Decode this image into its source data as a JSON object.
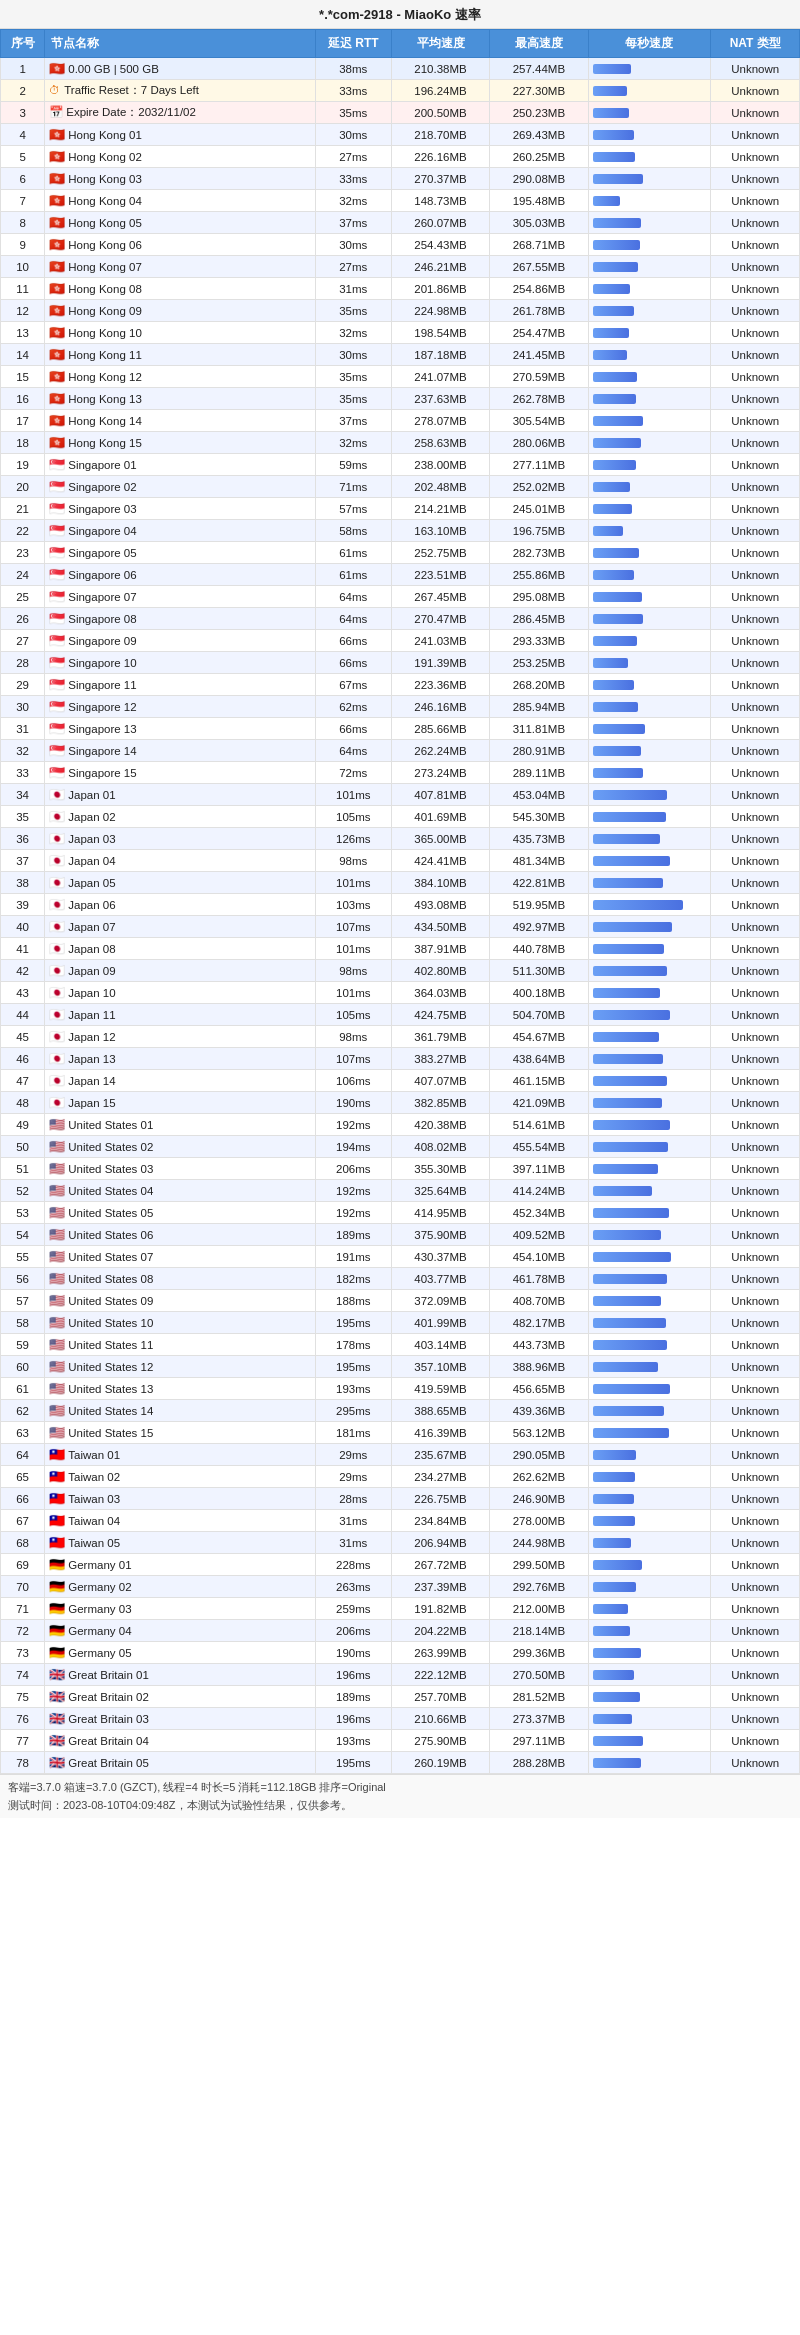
{
  "title": "*.*com-2918 - MiaoKo 速率",
  "headers": [
    "序号",
    "节点名称",
    "延迟 RTT",
    "平均速度",
    "最高速度",
    "每秒速度",
    "NAT 类型"
  ],
  "rows": [
    {
      "id": 1,
      "name": "0.00 GB | 500 GB",
      "flag": "🇭🇰",
      "rtt": "38ms",
      "avg": "210.38MB",
      "max": "257.44MB",
      "bar": 42,
      "nat": "Unknown",
      "special": "speed"
    },
    {
      "id": 2,
      "name": "Traffic Reset：7 Days Left",
      "flag": "",
      "rtt": "33ms",
      "avg": "196.24MB",
      "max": "227.30MB",
      "bar": 38,
      "nat": "Unknown",
      "special": "traffic"
    },
    {
      "id": 3,
      "name": "Expire Date：2032/11/02",
      "flag": "",
      "rtt": "35ms",
      "avg": "200.50MB",
      "max": "250.23MB",
      "bar": 40,
      "nat": "Unknown",
      "special": "expire"
    },
    {
      "id": 4,
      "name": "Hong Kong 01",
      "flag": "🇭🇰",
      "rtt": "30ms",
      "avg": "218.70MB",
      "max": "269.43MB",
      "bar": 45,
      "nat": "Unknown"
    },
    {
      "id": 5,
      "name": "Hong Kong 02",
      "flag": "🇭🇰",
      "rtt": "27ms",
      "avg": "226.16MB",
      "max": "260.25MB",
      "bar": 47,
      "nat": "Unknown"
    },
    {
      "id": 6,
      "name": "Hong Kong 03",
      "flag": "🇭🇰",
      "rtt": "33ms",
      "avg": "270.37MB",
      "max": "290.08MB",
      "bar": 55,
      "nat": "Unknown"
    },
    {
      "id": 7,
      "name": "Hong Kong 04",
      "flag": "🇭🇰",
      "rtt": "32ms",
      "avg": "148.73MB",
      "max": "195.48MB",
      "bar": 30,
      "nat": "Unknown"
    },
    {
      "id": 8,
      "name": "Hong Kong 05",
      "flag": "🇭🇰",
      "rtt": "37ms",
      "avg": "260.07MB",
      "max": "305.03MB",
      "bar": 53,
      "nat": "Unknown"
    },
    {
      "id": 9,
      "name": "Hong Kong 06",
      "flag": "🇭🇰",
      "rtt": "30ms",
      "avg": "254.43MB",
      "max": "268.71MB",
      "bar": 52,
      "nat": "Unknown"
    },
    {
      "id": 10,
      "name": "Hong Kong 07",
      "flag": "🇭🇰",
      "rtt": "27ms",
      "avg": "246.21MB",
      "max": "267.55MB",
      "bar": 50,
      "nat": "Unknown"
    },
    {
      "id": 11,
      "name": "Hong Kong 08",
      "flag": "🇭🇰",
      "rtt": "31ms",
      "avg": "201.86MB",
      "max": "254.86MB",
      "bar": 41,
      "nat": "Unknown"
    },
    {
      "id": 12,
      "name": "Hong Kong 09",
      "flag": "🇭🇰",
      "rtt": "35ms",
      "avg": "224.98MB",
      "max": "261.78MB",
      "bar": 46,
      "nat": "Unknown"
    },
    {
      "id": 13,
      "name": "Hong Kong 10",
      "flag": "🇭🇰",
      "rtt": "32ms",
      "avg": "198.54MB",
      "max": "254.47MB",
      "bar": 40,
      "nat": "Unknown"
    },
    {
      "id": 14,
      "name": "Hong Kong 11",
      "flag": "🇭🇰",
      "rtt": "30ms",
      "avg": "187.18MB",
      "max": "241.45MB",
      "bar": 38,
      "nat": "Unknown"
    },
    {
      "id": 15,
      "name": "Hong Kong 12",
      "flag": "🇭🇰",
      "rtt": "35ms",
      "avg": "241.07MB",
      "max": "270.59MB",
      "bar": 49,
      "nat": "Unknown"
    },
    {
      "id": 16,
      "name": "Hong Kong 13",
      "flag": "🇭🇰",
      "rtt": "35ms",
      "avg": "237.63MB",
      "max": "262.78MB",
      "bar": 48,
      "nat": "Unknown"
    },
    {
      "id": 17,
      "name": "Hong Kong 14",
      "flag": "🇭🇰",
      "rtt": "37ms",
      "avg": "278.07MB",
      "max": "305.54MB",
      "bar": 56,
      "nat": "Unknown"
    },
    {
      "id": 18,
      "name": "Hong Kong 15",
      "flag": "🇭🇰",
      "rtt": "32ms",
      "avg": "258.63MB",
      "max": "280.06MB",
      "bar": 53,
      "nat": "Unknown"
    },
    {
      "id": 19,
      "name": "Singapore 01",
      "flag": "🇸🇬",
      "rtt": "59ms",
      "avg": "238.00MB",
      "max": "277.11MB",
      "bar": 48,
      "nat": "Unknown"
    },
    {
      "id": 20,
      "name": "Singapore 02",
      "flag": "🇸🇬",
      "rtt": "71ms",
      "avg": "202.48MB",
      "max": "252.02MB",
      "bar": 41,
      "nat": "Unknown"
    },
    {
      "id": 21,
      "name": "Singapore 03",
      "flag": "🇸🇬",
      "rtt": "57ms",
      "avg": "214.21MB",
      "max": "245.01MB",
      "bar": 43,
      "nat": "Unknown"
    },
    {
      "id": 22,
      "name": "Singapore 04",
      "flag": "🇸🇬",
      "rtt": "58ms",
      "avg": "163.10MB",
      "max": "196.75MB",
      "bar": 33,
      "nat": "Unknown"
    },
    {
      "id": 23,
      "name": "Singapore 05",
      "flag": "🇸🇬",
      "rtt": "61ms",
      "avg": "252.75MB",
      "max": "282.73MB",
      "bar": 51,
      "nat": "Unknown"
    },
    {
      "id": 24,
      "name": "Singapore 06",
      "flag": "🇸🇬",
      "rtt": "61ms",
      "avg": "223.51MB",
      "max": "255.86MB",
      "bar": 45,
      "nat": "Unknown"
    },
    {
      "id": 25,
      "name": "Singapore 07",
      "flag": "🇸🇬",
      "rtt": "64ms",
      "avg": "267.45MB",
      "max": "295.08MB",
      "bar": 54,
      "nat": "Unknown"
    },
    {
      "id": 26,
      "name": "Singapore 08",
      "flag": "🇸🇬",
      "rtt": "64ms",
      "avg": "270.47MB",
      "max": "286.45MB",
      "bar": 55,
      "nat": "Unknown"
    },
    {
      "id": 27,
      "name": "Singapore 09",
      "flag": "🇸🇬",
      "rtt": "66ms",
      "avg": "241.03MB",
      "max": "293.33MB",
      "bar": 49,
      "nat": "Unknown"
    },
    {
      "id": 28,
      "name": "Singapore 10",
      "flag": "🇸🇬",
      "rtt": "66ms",
      "avg": "191.39MB",
      "max": "253.25MB",
      "bar": 39,
      "nat": "Unknown"
    },
    {
      "id": 29,
      "name": "Singapore 11",
      "flag": "🇸🇬",
      "rtt": "67ms",
      "avg": "223.36MB",
      "max": "268.20MB",
      "bar": 45,
      "nat": "Unknown"
    },
    {
      "id": 30,
      "name": "Singapore 12",
      "flag": "🇸🇬",
      "rtt": "62ms",
      "avg": "246.16MB",
      "max": "285.94MB",
      "bar": 50,
      "nat": "Unknown"
    },
    {
      "id": 31,
      "name": "Singapore 13",
      "flag": "🇸🇬",
      "rtt": "66ms",
      "avg": "285.66MB",
      "max": "311.81MB",
      "bar": 58,
      "nat": "Unknown"
    },
    {
      "id": 32,
      "name": "Singapore 14",
      "flag": "🇸🇬",
      "rtt": "64ms",
      "avg": "262.24MB",
      "max": "280.91MB",
      "bar": 53,
      "nat": "Unknown"
    },
    {
      "id": 33,
      "name": "Singapore 15",
      "flag": "🇸🇬",
      "rtt": "72ms",
      "avg": "273.24MB",
      "max": "289.11MB",
      "bar": 55,
      "nat": "Unknown"
    },
    {
      "id": 34,
      "name": "Japan 01",
      "flag": "🇯🇵",
      "rtt": "101ms",
      "avg": "407.81MB",
      "max": "453.04MB",
      "bar": 82,
      "nat": "Unknown"
    },
    {
      "id": 35,
      "name": "Japan 02",
      "flag": "🇯🇵",
      "rtt": "105ms",
      "avg": "401.69MB",
      "max": "545.30MB",
      "bar": 81,
      "nat": "Unknown"
    },
    {
      "id": 36,
      "name": "Japan 03",
      "flag": "🇯🇵",
      "rtt": "126ms",
      "avg": "365.00MB",
      "max": "435.73MB",
      "bar": 74,
      "nat": "Unknown"
    },
    {
      "id": 37,
      "name": "Japan 04",
      "flag": "🇯🇵",
      "rtt": "98ms",
      "avg": "424.41MB",
      "max": "481.34MB",
      "bar": 86,
      "nat": "Unknown"
    },
    {
      "id": 38,
      "name": "Japan 05",
      "flag": "🇯🇵",
      "rtt": "101ms",
      "avg": "384.10MB",
      "max": "422.81MB",
      "bar": 78,
      "nat": "Unknown"
    },
    {
      "id": 39,
      "name": "Japan 06",
      "flag": "🇯🇵",
      "rtt": "103ms",
      "avg": "493.08MB",
      "max": "519.95MB",
      "bar": 100,
      "nat": "Unknown"
    },
    {
      "id": 40,
      "name": "Japan 07",
      "flag": "🇯🇵",
      "rtt": "107ms",
      "avg": "434.50MB",
      "max": "492.97MB",
      "bar": 88,
      "nat": "Unknown"
    },
    {
      "id": 41,
      "name": "Japan 08",
      "flag": "🇯🇵",
      "rtt": "101ms",
      "avg": "387.91MB",
      "max": "440.78MB",
      "bar": 79,
      "nat": "Unknown"
    },
    {
      "id": 42,
      "name": "Japan 09",
      "flag": "🇯🇵",
      "rtt": "98ms",
      "avg": "402.80MB",
      "max": "511.30MB",
      "bar": 82,
      "nat": "Unknown"
    },
    {
      "id": 43,
      "name": "Japan 10",
      "flag": "🇯🇵",
      "rtt": "101ms",
      "avg": "364.03MB",
      "max": "400.18MB",
      "bar": 74,
      "nat": "Unknown"
    },
    {
      "id": 44,
      "name": "Japan 11",
      "flag": "🇯🇵",
      "rtt": "105ms",
      "avg": "424.75MB",
      "max": "504.70MB",
      "bar": 86,
      "nat": "Unknown"
    },
    {
      "id": 45,
      "name": "Japan 12",
      "flag": "🇯🇵",
      "rtt": "98ms",
      "avg": "361.79MB",
      "max": "454.67MB",
      "bar": 73,
      "nat": "Unknown"
    },
    {
      "id": 46,
      "name": "Japan 13",
      "flag": "🇯🇵",
      "rtt": "107ms",
      "avg": "383.27MB",
      "max": "438.64MB",
      "bar": 78,
      "nat": "Unknown"
    },
    {
      "id": 47,
      "name": "Japan 14",
      "flag": "🇯🇵",
      "rtt": "106ms",
      "avg": "407.07MB",
      "max": "461.15MB",
      "bar": 82,
      "nat": "Unknown"
    },
    {
      "id": 48,
      "name": "Japan 15",
      "flag": "🇯🇵",
      "rtt": "190ms",
      "avg": "382.85MB",
      "max": "421.09MB",
      "bar": 77,
      "nat": "Unknown"
    },
    {
      "id": 49,
      "name": "United States 01",
      "flag": "🇺🇸",
      "rtt": "192ms",
      "avg": "420.38MB",
      "max": "514.61MB",
      "bar": 85,
      "nat": "Unknown"
    },
    {
      "id": 50,
      "name": "United States 02",
      "flag": "🇺🇸",
      "rtt": "194ms",
      "avg": "408.02MB",
      "max": "455.54MB",
      "bar": 83,
      "nat": "Unknown"
    },
    {
      "id": 51,
      "name": "United States 03",
      "flag": "🇺🇸",
      "rtt": "206ms",
      "avg": "355.30MB",
      "max": "397.11MB",
      "bar": 72,
      "nat": "Unknown"
    },
    {
      "id": 52,
      "name": "United States 04",
      "flag": "🇺🇸",
      "rtt": "192ms",
      "avg": "325.64MB",
      "max": "414.24MB",
      "bar": 66,
      "nat": "Unknown"
    },
    {
      "id": 53,
      "name": "United States 05",
      "flag": "🇺🇸",
      "rtt": "192ms",
      "avg": "414.95MB",
      "max": "452.34MB",
      "bar": 84,
      "nat": "Unknown"
    },
    {
      "id": 54,
      "name": "United States 06",
      "flag": "🇺🇸",
      "rtt": "189ms",
      "avg": "375.90MB",
      "max": "409.52MB",
      "bar": 76,
      "nat": "Unknown"
    },
    {
      "id": 55,
      "name": "United States 07",
      "flag": "🇺🇸",
      "rtt": "191ms",
      "avg": "430.37MB",
      "max": "454.10MB",
      "bar": 87,
      "nat": "Unknown"
    },
    {
      "id": 56,
      "name": "United States 08",
      "flag": "🇺🇸",
      "rtt": "182ms",
      "avg": "403.77MB",
      "max": "461.78MB",
      "bar": 82,
      "nat": "Unknown"
    },
    {
      "id": 57,
      "name": "United States 09",
      "flag": "🇺🇸",
      "rtt": "188ms",
      "avg": "372.09MB",
      "max": "408.70MB",
      "bar": 75,
      "nat": "Unknown"
    },
    {
      "id": 58,
      "name": "United States 10",
      "flag": "🇺🇸",
      "rtt": "195ms",
      "avg": "401.99MB",
      "max": "482.17MB",
      "bar": 81,
      "nat": "Unknown"
    },
    {
      "id": 59,
      "name": "United States 11",
      "flag": "🇺🇸",
      "rtt": "178ms",
      "avg": "403.14MB",
      "max": "443.73MB",
      "bar": 82,
      "nat": "Unknown"
    },
    {
      "id": 60,
      "name": "United States 12",
      "flag": "🇺🇸",
      "rtt": "195ms",
      "avg": "357.10MB",
      "max": "388.96MB",
      "bar": 72,
      "nat": "Unknown"
    },
    {
      "id": 61,
      "name": "United States 13",
      "flag": "🇺🇸",
      "rtt": "193ms",
      "avg": "419.59MB",
      "max": "456.65MB",
      "bar": 85,
      "nat": "Unknown"
    },
    {
      "id": 62,
      "name": "United States 14",
      "flag": "🇺🇸",
      "rtt": "295ms",
      "avg": "388.65MB",
      "max": "439.36MB",
      "bar": 79,
      "nat": "Unknown"
    },
    {
      "id": 63,
      "name": "United States 15",
      "flag": "🇺🇸",
      "rtt": "181ms",
      "avg": "416.39MB",
      "max": "563.12MB",
      "bar": 84,
      "nat": "Unknown"
    },
    {
      "id": 64,
      "name": "Taiwan 01",
      "flag": "🇹🇼",
      "rtt": "29ms",
      "avg": "235.67MB",
      "max": "290.05MB",
      "bar": 48,
      "nat": "Unknown"
    },
    {
      "id": 65,
      "name": "Taiwan 02",
      "flag": "🇹🇼",
      "rtt": "29ms",
      "avg": "234.27MB",
      "max": "262.62MB",
      "bar": 47,
      "nat": "Unknown"
    },
    {
      "id": 66,
      "name": "Taiwan 03",
      "flag": "🇹🇼",
      "rtt": "28ms",
      "avg": "226.75MB",
      "max": "246.90MB",
      "bar": 46,
      "nat": "Unknown"
    },
    {
      "id": 67,
      "name": "Taiwan 04",
      "flag": "🇹🇼",
      "rtt": "31ms",
      "avg": "234.84MB",
      "max": "278.00MB",
      "bar": 47,
      "nat": "Unknown"
    },
    {
      "id": 68,
      "name": "Taiwan 05",
      "flag": "🇹🇼",
      "rtt": "31ms",
      "avg": "206.94MB",
      "max": "244.98MB",
      "bar": 42,
      "nat": "Unknown"
    },
    {
      "id": 69,
      "name": "Germany 01",
      "flag": "🇩🇪",
      "rtt": "228ms",
      "avg": "267.72MB",
      "max": "299.50MB",
      "bar": 54,
      "nat": "Unknown"
    },
    {
      "id": 70,
      "name": "Germany 02",
      "flag": "🇩🇪",
      "rtt": "263ms",
      "avg": "237.39MB",
      "max": "292.76MB",
      "bar": 48,
      "nat": "Unknown"
    },
    {
      "id": 71,
      "name": "Germany 03",
      "flag": "🇩🇪",
      "rtt": "259ms",
      "avg": "191.82MB",
      "max": "212.00MB",
      "bar": 39,
      "nat": "Unknown"
    },
    {
      "id": 72,
      "name": "Germany 04",
      "flag": "🇩🇪",
      "rtt": "206ms",
      "avg": "204.22MB",
      "max": "218.14MB",
      "bar": 41,
      "nat": "Unknown"
    },
    {
      "id": 73,
      "name": "Germany 05",
      "flag": "🇩🇪",
      "rtt": "190ms",
      "avg": "263.99MB",
      "max": "299.36MB",
      "bar": 53,
      "nat": "Unknown"
    },
    {
      "id": 74,
      "name": "Great Britain 01",
      "flag": "🇬🇧",
      "rtt": "196ms",
      "avg": "222.12MB",
      "max": "270.50MB",
      "bar": 45,
      "nat": "Unknown"
    },
    {
      "id": 75,
      "name": "Great Britain 02",
      "flag": "🇬🇧",
      "rtt": "189ms",
      "avg": "257.70MB",
      "max": "281.52MB",
      "bar": 52,
      "nat": "Unknown"
    },
    {
      "id": 76,
      "name": "Great Britain 03",
      "flag": "🇬🇧",
      "rtt": "196ms",
      "avg": "210.66MB",
      "max": "273.37MB",
      "bar": 43,
      "nat": "Unknown"
    },
    {
      "id": 77,
      "name": "Great Britain 04",
      "flag": "🇬🇧",
      "rtt": "193ms",
      "avg": "275.90MB",
      "max": "297.11MB",
      "bar": 56,
      "nat": "Unknown"
    },
    {
      "id": 78,
      "name": "Great Britain 05",
      "flag": "🇬🇧",
      "rtt": "195ms",
      "avg": "260.19MB",
      "max": "288.28MB",
      "bar": 53,
      "nat": "Unknown"
    }
  ],
  "footer1": "客端=3.7.0 箱速=3.7.0 (GZCT), 线程=4 时长=5 消耗=112.18GB 排序=Original",
  "footer2": "测试时间：2023-08-10T04:09:48Z，本测试为试验性结果，仅供参考。"
}
